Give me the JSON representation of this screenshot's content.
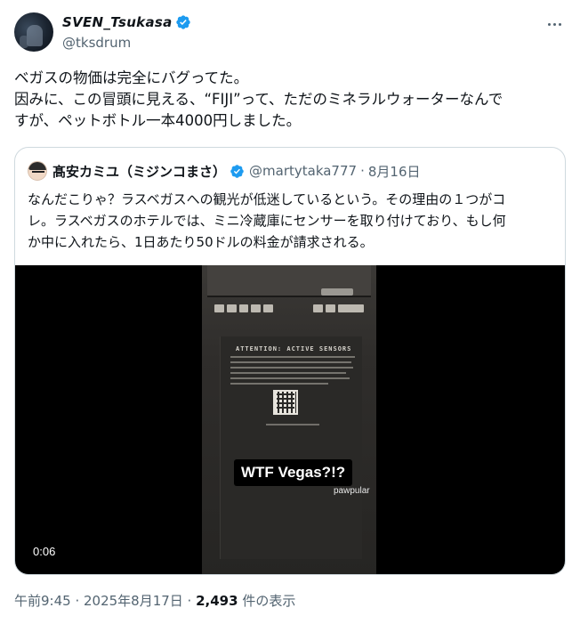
{
  "author": {
    "display_name": "SVEN_Tsukasa",
    "handle": "@tksdrum"
  },
  "tweet": {
    "lines": [
      "ベガスの物価は完全にバグってた。",
      "因みに、この冒頭に見える、“FIJI”って、ただのミネラルウォーターなんで",
      "すが、ペットボトル一本4000円しました。"
    ]
  },
  "quote": {
    "display_name": "髙安カミユ（ミジンコまさ）",
    "handle": "@martytaka777",
    "separator": "·",
    "date": "8月16日",
    "lines": [
      "なんだこりゃ？ラスベガスへの観光が低迷しているという。その理由の１つがコ",
      "レ。ラスベガスのホテルでは、ミニ冷蔵庫にセンサーを取り付けており、もし何",
      "か中に入れたら、1日あたり50ドルの料金が請求される。"
    ],
    "video": {
      "sign_title": "ATTENTION: ACTIVE SENSORS",
      "caption": "WTF Vegas?!?",
      "watermark": "pawpular",
      "duration": "0:06"
    }
  },
  "meta": {
    "time_date": "午前9:45 · 2025年8月17日 · ",
    "views_count": "2,493",
    "views_label": " 件の表示"
  },
  "colors": {
    "verified_blue": "#1d9bf0",
    "text_secondary": "#536471",
    "border": "#cfd9de"
  },
  "icons": {
    "verified": "verified-badge-icon",
    "more": "more-horizontal-icon"
  }
}
